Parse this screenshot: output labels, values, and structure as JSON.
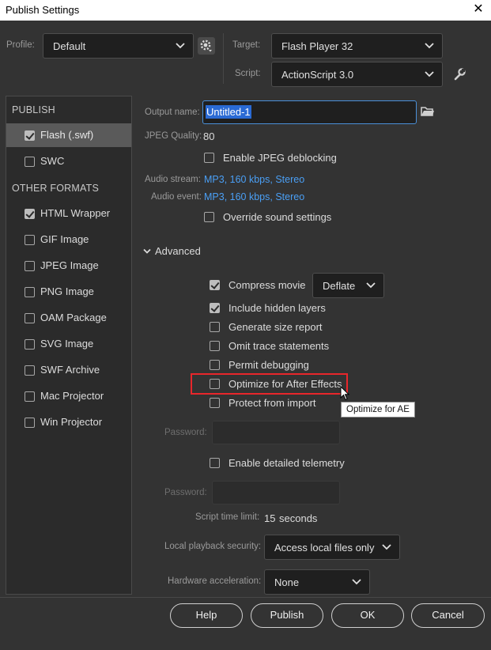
{
  "window": {
    "title": "Publish Settings",
    "close_glyph": "✕"
  },
  "profile": {
    "label": "Profile:",
    "value": "Default"
  },
  "target": {
    "label": "Target:",
    "value": "Flash Player 32"
  },
  "script": {
    "label": "Script:",
    "value": "ActionScript 3.0"
  },
  "sidebar": {
    "publish_header": "PUBLISH",
    "publish_items": [
      {
        "label": "Flash (.swf)",
        "checked": true
      },
      {
        "label": "SWC",
        "checked": false
      }
    ],
    "other_header": "OTHER FORMATS",
    "other_items": [
      {
        "label": "HTML Wrapper",
        "checked": true
      },
      {
        "label": "GIF Image",
        "checked": false
      },
      {
        "label": "JPEG Image",
        "checked": false
      },
      {
        "label": "PNG Image",
        "checked": false
      },
      {
        "label": "OAM Package",
        "checked": false
      },
      {
        "label": "SVG Image",
        "checked": false
      },
      {
        "label": "SWF Archive",
        "checked": false
      },
      {
        "label": "Mac Projector",
        "checked": false
      },
      {
        "label": "Win Projector",
        "checked": false
      }
    ]
  },
  "main": {
    "output_name_label": "Output name:",
    "output_name_value": "Untitled-1",
    "jpeg_quality_label": "JPEG Quality:",
    "jpeg_quality_value": "80",
    "enable_jpeg_deblocking": "Enable JPEG deblocking",
    "audio_stream_label": "Audio stream:",
    "audio_stream_value": "MP3, 160 kbps, Stereo",
    "audio_event_label": "Audio event:",
    "audio_event_value": "MP3, 160 kbps, Stereo",
    "override_sound": "Override sound settings",
    "advanced_label": "Advanced",
    "compress_movie": "Compress movie",
    "compress_value": "Deflate",
    "include_hidden_layers": "Include hidden layers",
    "generate_size_report": "Generate size report",
    "omit_trace": "Omit trace statements",
    "permit_debugging": "Permit debugging",
    "optimize_ae": "Optimize for After Effects",
    "protect_import": "Protect from import",
    "password_label": "Password:",
    "enable_telemetry": "Enable detailed telemetry",
    "password2_label": "Password:",
    "script_time_label": "Script time limit:",
    "script_time_value": "15",
    "script_time_unit": "seconds",
    "local_playback_label": "Local playback security:",
    "local_playback_value": "Access local files only",
    "hw_accel_label": "Hardware acceleration:",
    "hw_accel_value": "None"
  },
  "tooltip": "Optimize for AE",
  "buttons": {
    "help": "Help",
    "publish": "Publish",
    "ok": "OK",
    "cancel": "Cancel"
  },
  "colors": {
    "background": "#333333",
    "link": "#4a9ff5",
    "highlight": "#e8262b",
    "selected": "#5a5a5a"
  }
}
